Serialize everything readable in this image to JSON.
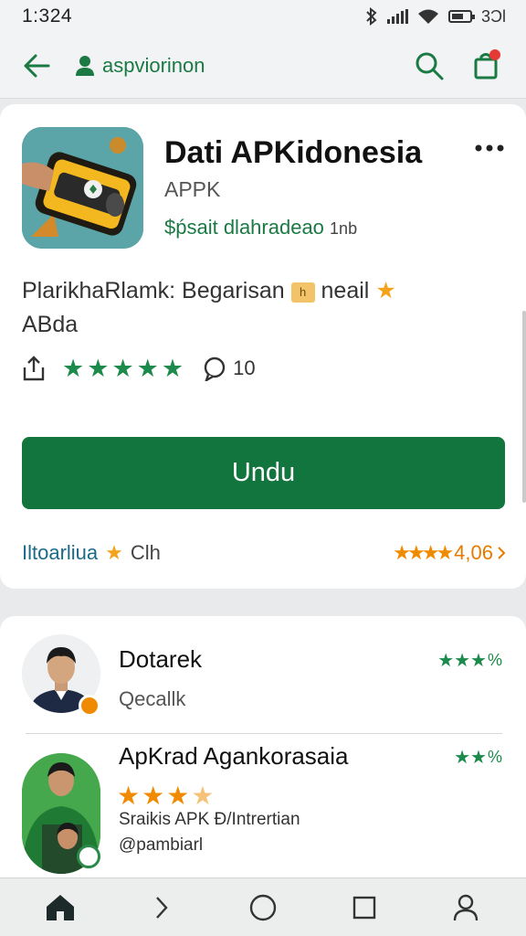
{
  "status_bar": {
    "time": "1:324",
    "battery_text": "3Ɔl"
  },
  "app_bar": {
    "back_icon": "arrow-left-icon",
    "account_label": "aspviorinon",
    "search_icon": "search-icon",
    "bag_icon": "shopping-bag-icon"
  },
  "app": {
    "title": "Dati APKidonesia",
    "developer": "APPK",
    "tagline": "$ṕsait dlahradeao",
    "tagline_suffix": "1nb",
    "more_icon": "more-horizontal-icon",
    "description_part1": "PlarikhaRlamk: Begarisan",
    "badge_text": "h",
    "description_part2": "neail",
    "description_line2": "ABda",
    "rating_stars": 5,
    "comment_count": "10",
    "install_label": "Undu",
    "footer_left": "Iltoarliua",
    "footer_left_suffix": "Clh",
    "footer_right_value": "4,06",
    "footer_right_stars": 4
  },
  "reviews": [
    {
      "name": "Dotarek",
      "subtitle": "Qecallk",
      "rating_text": "%"
    },
    {
      "name": "ApKrad Agankorasaia",
      "rating_text": "%",
      "stars": 4,
      "line1": "Sraikis APK Ð/Intrertian",
      "line2": "@pambiarl"
    }
  ],
  "bottom_nav": [
    "home-icon",
    "chevron-right-icon",
    "circle-home-icon",
    "square-recents-icon",
    "profile-icon"
  ],
  "colors": {
    "accent": "#13753e",
    "link_green": "#1b7a44",
    "star_orange": "#f08a00",
    "notification": "#e53935"
  }
}
